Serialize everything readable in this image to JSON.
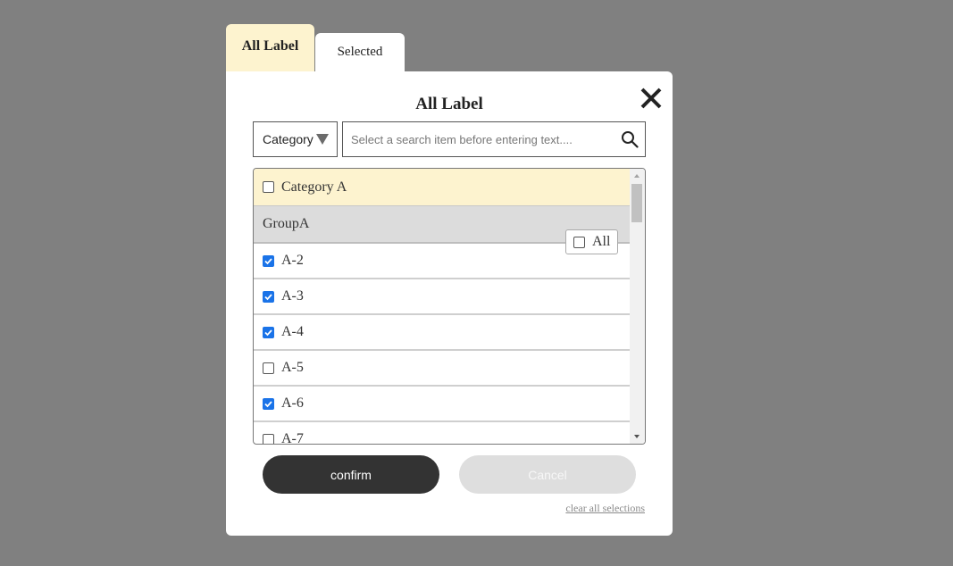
{
  "tabs": {
    "all_label": "All Label",
    "selected": "Selected"
  },
  "modal": {
    "title": "All Label",
    "close_icon": "close-icon"
  },
  "filter": {
    "category_label": "Category"
  },
  "search": {
    "placeholder": "Select a search item before entering text....",
    "icon": "search-icon"
  },
  "list": {
    "category": {
      "label": "Category A",
      "checked": false
    },
    "group": {
      "label": "GroupA",
      "all_label": "All",
      "all_checked": false
    },
    "items": [
      {
        "label": "A-2",
        "checked": true
      },
      {
        "label": "A-3",
        "checked": true
      },
      {
        "label": "A-4",
        "checked": true
      },
      {
        "label": "A-5",
        "checked": false
      },
      {
        "label": "A-6",
        "checked": true
      },
      {
        "label": "A-7",
        "checked": false
      }
    ]
  },
  "actions": {
    "confirm": "confirm",
    "cancel": "Cancel",
    "clear_all": "clear all selections"
  },
  "colors": {
    "overlay": "#808080",
    "active_tab": "#fdf3cf",
    "category_row": "#fdf3cf",
    "group_row": "#dcdcdc",
    "checkbox_checked": "#1a73e8",
    "confirm_button": "#333333",
    "cancel_button": "#dedede"
  }
}
